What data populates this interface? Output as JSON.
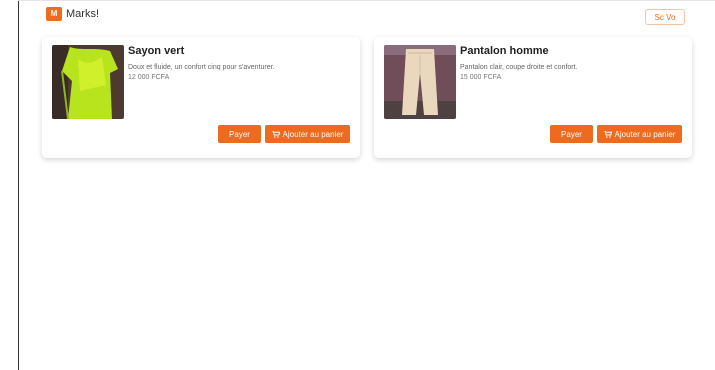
{
  "header": {
    "brand_label": "Marks!",
    "logo_text": "M",
    "top_right_label": "Sc Vo"
  },
  "colors": {
    "accent": "#ee6a1f"
  },
  "cards": [
    {
      "title": "Sayon vert",
      "description": "Doux et fluide, un confort cinq pour s'aventurer.",
      "price": "12 000 FCFA",
      "pay_label": "Payer",
      "cart_label": "Ajouter au panier",
      "image": "image-vert"
    },
    {
      "title": "Pantalon homme",
      "description": "Pantalon clair, coupe droite et confort.",
      "price": "15 000 FCFA",
      "pay_label": "Payer",
      "cart_label": "Ajouter au panier",
      "image": "image-beige"
    }
  ]
}
